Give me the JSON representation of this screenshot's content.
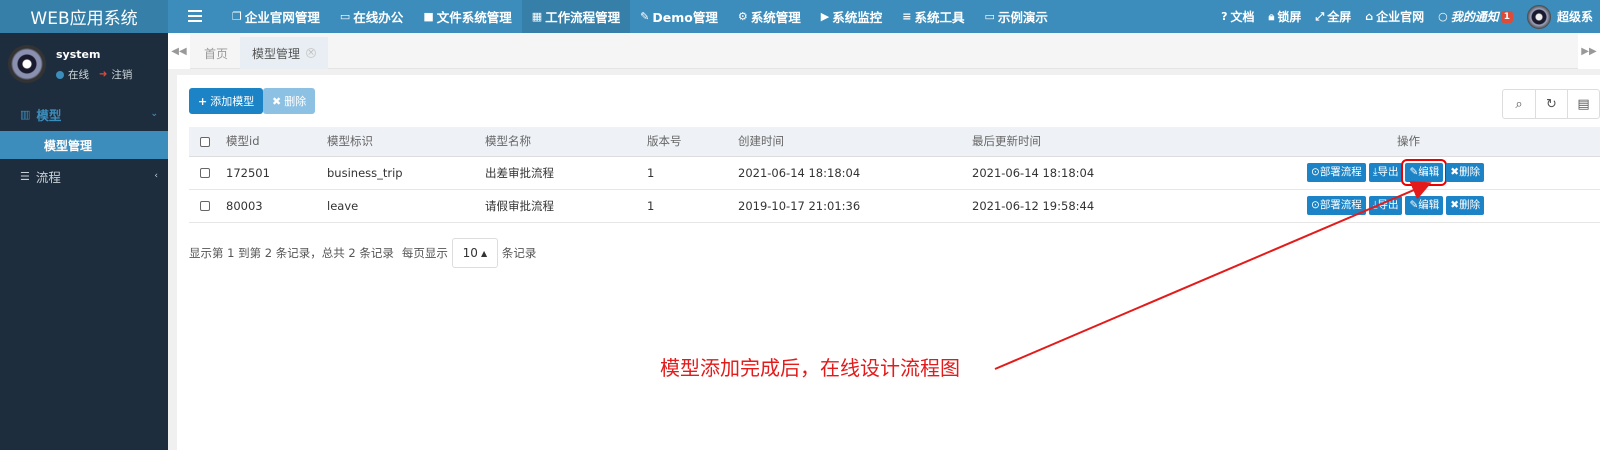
{
  "app": {
    "title": "WEB应用系统"
  },
  "topnav": {
    "items": [
      {
        "label": "企业官网管理",
        "icon": "copy-icon",
        "glyph": "❐"
      },
      {
        "label": "在线办公",
        "icon": "id-card-icon",
        "glyph": "▭"
      },
      {
        "label": "文件系统管理",
        "icon": "folder-icon",
        "glyph": "■"
      },
      {
        "label": "工作流程管理",
        "icon": "workflow-icon",
        "glyph": "▦"
      },
      {
        "label": "Demo管理",
        "icon": "edit-icon",
        "glyph": "✎"
      },
      {
        "label": "系统管理",
        "icon": "gear-icon",
        "glyph": "⚙"
      },
      {
        "label": "系统监控",
        "icon": "video-camera-icon",
        "glyph": "▶"
      },
      {
        "label": "系统工具",
        "icon": "list-icon",
        "glyph": "≡"
      },
      {
        "label": "示例演示",
        "icon": "desktop-icon",
        "glyph": "▭"
      }
    ],
    "right": {
      "docs": "文档",
      "lock": "锁屏",
      "fullscreen": "全屏",
      "website": "企业官网",
      "notice": "我的通知",
      "notice_count": "1",
      "user": "超级系"
    }
  },
  "sidebar": {
    "user": {
      "name": "system",
      "status": "在线",
      "logout": "注销"
    },
    "groups": [
      {
        "label": "模型",
        "items": [
          {
            "label": "模型管理"
          }
        ]
      },
      {
        "label": "流程"
      }
    ]
  },
  "tabs": [
    {
      "label": "首页"
    },
    {
      "label": "模型管理"
    }
  ],
  "toolbar": {
    "add": "添加模型",
    "delete": "删除"
  },
  "table": {
    "headers": [
      "模型id",
      "模型标识",
      "模型名称",
      "版本号",
      "创建时间",
      "最后更新时间",
      "操作"
    ],
    "rows": [
      {
        "id": "172501",
        "key": "business_trip",
        "name": "出差审批流程",
        "version": "1",
        "created": "2021-06-14 18:18:04",
        "updated": "2021-06-14 18:18:04"
      },
      {
        "id": "80003",
        "key": "leave",
        "name": "请假审批流程",
        "version": "1",
        "created": "2019-10-17 21:01:36",
        "updated": "2021-06-12 19:58:44"
      }
    ],
    "ops": {
      "deploy": "部署流程",
      "export": "导出",
      "edit": "编辑",
      "remove": "删除"
    }
  },
  "pager": {
    "summary": "显示第 1 到第 2 条记录，总共 2 条记录",
    "per_page_label": "每页显示",
    "page_size": "10",
    "suffix": "条记录"
  },
  "annotation": {
    "text": "模型添加完成后，在线设计流程图",
    "color": "#e31b1b"
  },
  "colors": {
    "primary": "#3c8dbc",
    "sidebar": "#1e2d3d",
    "button": "#1c84c6"
  }
}
